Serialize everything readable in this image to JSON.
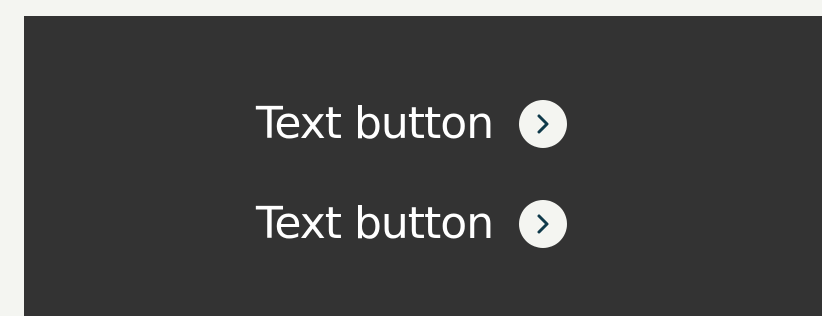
{
  "buttons": [
    {
      "label": "Text button",
      "icon": "chevron-right-icon"
    },
    {
      "label": "Text button",
      "icon": "chevron-right-icon"
    }
  ],
  "colors": {
    "page_background": "#f4f5f1",
    "panel_background": "#333333",
    "text": "#ffffff",
    "icon_circle": "#f4f5f1",
    "icon_chevron": "#0f3a4a"
  }
}
